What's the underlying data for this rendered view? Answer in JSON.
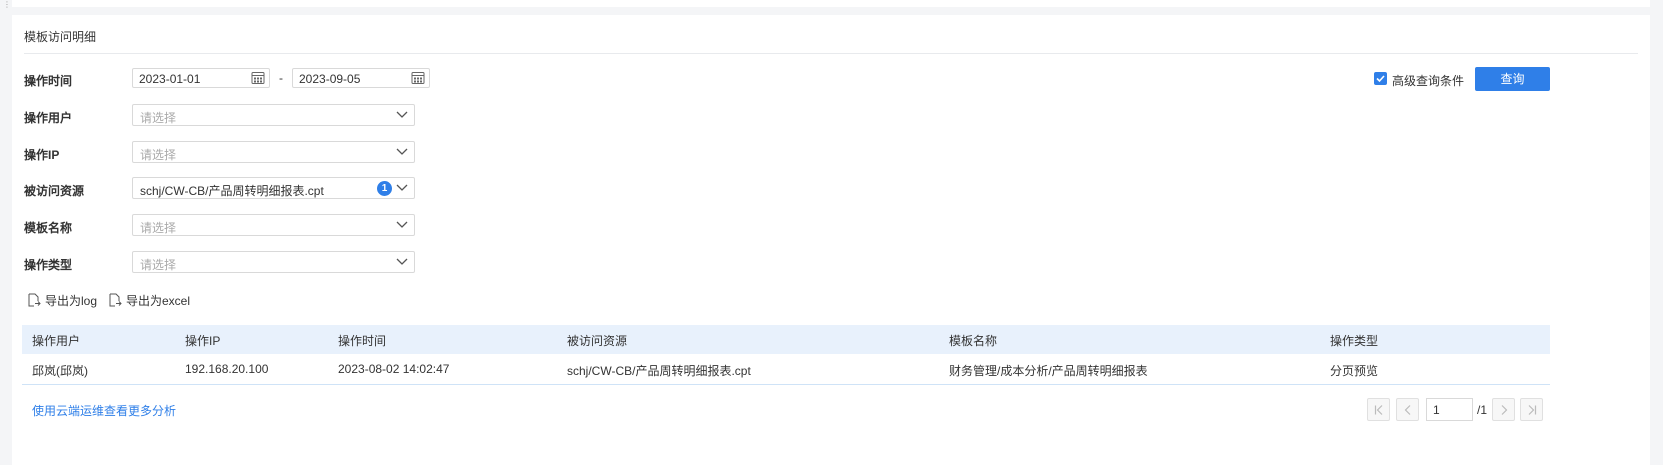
{
  "section_title": "模板访问明细",
  "filters": {
    "op_time_label": "操作时间",
    "date_start": "2023-01-01",
    "date_sep": "-",
    "date_end": "2023-09-05",
    "op_user_label": "操作用户",
    "op_user_placeholder": "请选择",
    "op_ip_label": "操作IP",
    "op_ip_placeholder": "请选择",
    "resource_label": "被访问资源",
    "resource_value": "schj/CW-CB/产品周转明细报表.cpt",
    "resource_count": "1",
    "template_name_label": "模板名称",
    "template_name_placeholder": "请选择",
    "op_type_label": "操作类型",
    "op_type_placeholder": "请选择"
  },
  "advanced": {
    "label": "高级查询条件",
    "checked": true
  },
  "query_button": "查询",
  "export": {
    "log_label": "导出为log",
    "excel_label": "导出为excel"
  },
  "table": {
    "headers": [
      "操作用户",
      "操作IP",
      "操作时间",
      "被访问资源",
      "模板名称",
      "操作类型"
    ],
    "rows": [
      [
        "邱岚(邱岚)",
        "192.168.20.100",
        "2023-08-02 14:02:47",
        "schj/CW-CB/产品周转明细报表.cpt",
        "财务管理/成本分析/产品周转明细报表",
        "分页预览"
      ]
    ]
  },
  "footer_link": "使用云端运维查看更多分析",
  "pagination": {
    "current": "1",
    "total": "/1"
  },
  "colors": {
    "accent": "#2f7fe8",
    "header_bg": "#e8f1fc"
  }
}
